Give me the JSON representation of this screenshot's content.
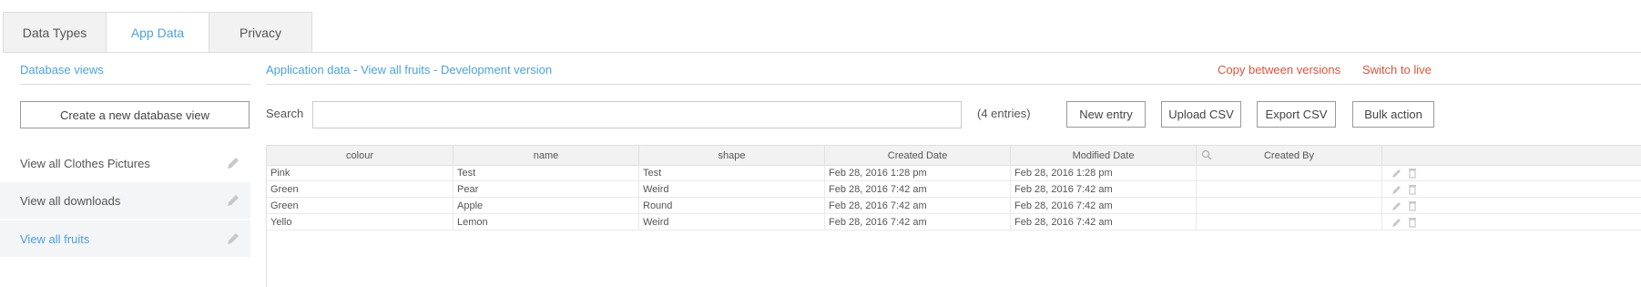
{
  "tabs": [
    {
      "label": "Data Types"
    },
    {
      "label": "App Data"
    },
    {
      "label": "Privacy"
    }
  ],
  "sidebar": {
    "title": "Database views",
    "create_label": "Create a new database view",
    "items": [
      {
        "label": "View all Clothes Pictures"
      },
      {
        "label": "View all downloads"
      },
      {
        "label": "View all fruits"
      }
    ]
  },
  "main": {
    "title": "Application data - View all fruits - Development version",
    "copy_link": "Copy between versions",
    "switch_link": "Switch to live",
    "search_label": "Search",
    "search_value": "",
    "entries": "(4 entries)",
    "buttons": {
      "new_entry": "New entry",
      "upload_csv": "Upload CSV",
      "export_csv": "Export CSV",
      "bulk_action": "Bulk action"
    }
  },
  "table": {
    "columns": [
      "colour",
      "name",
      "shape",
      "Created Date",
      "Modified Date",
      "Created By"
    ],
    "rows": [
      [
        "Pink",
        "Test",
        "Test",
        "Feb 28, 2016 1:28 pm",
        "Feb 28, 2016 1:28 pm",
        ""
      ],
      [
        "Green",
        "Pear",
        "Weird",
        "Feb 28, 2016 7:42 am",
        "Feb 28, 2016 7:42 am",
        ""
      ],
      [
        "Green",
        "Apple",
        "Round",
        "Feb 28, 2016 7:42 am",
        "Feb 28, 2016 7:42 am",
        ""
      ],
      [
        "Yello",
        "Lemon",
        "Weird",
        "Feb 28, 2016 7:42 am",
        "Feb 28, 2016 7:42 am",
        ""
      ]
    ]
  },
  "icons": {
    "edit": "pencil-icon",
    "delete": "trash-icon",
    "search": "search-icon"
  },
  "colors": {
    "link_blue": "#4aa3df",
    "link_red": "#e0533a",
    "header_bg": "#f2f2f2"
  }
}
